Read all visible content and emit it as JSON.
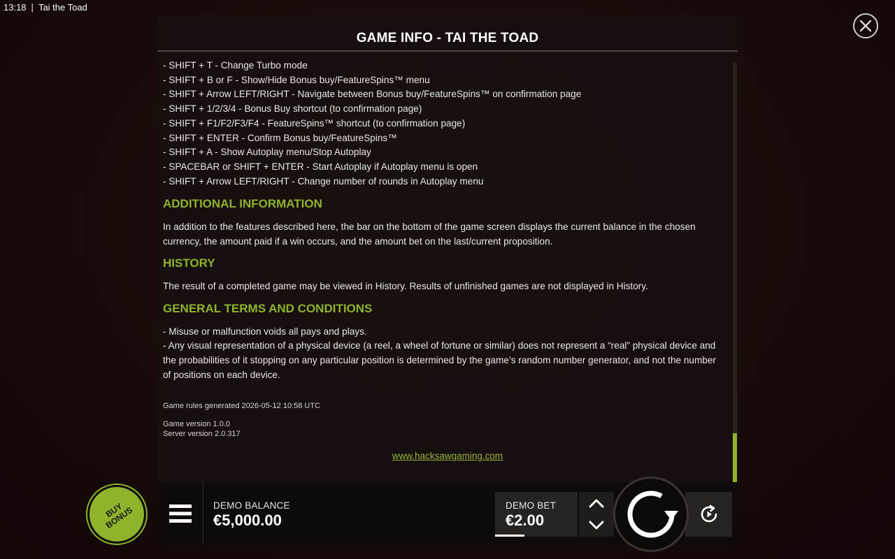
{
  "status_bar": {
    "time": "13:18",
    "app_title": "Tai the Toad"
  },
  "panel": {
    "title": "GAME INFO - TAI THE TOAD",
    "shortcuts": [
      "- SHIFT + T - Change Turbo mode",
      "- SHIFT + B or F - Show/Hide Bonus buy/FeatureSpins™ menu",
      "- SHIFT + Arrow LEFT/RIGHT - Navigate between Bonus buy/FeatureSpins™ on confirmation page",
      "- SHIFT + 1/2/3/4 - Bonus Buy shortcut (to confirmation page)",
      "- SHIFT + F1/F2/F3/F4 - FeatureSpins™ shortcut (to confirmation page)",
      "- SHIFT + ENTER - Confirm Bonus buy/FeatureSpins™",
      "- SHIFT + A - Show Autoplay menu/Stop Autoplay",
      "- SPACEBAR or SHIFT + ENTER - Start Autoplay if Autoplay menu is open",
      "- SHIFT + Arrow LEFT/RIGHT - Change number of rounds in Autoplay menu"
    ],
    "additional_heading": "ADDITIONAL INFORMATION",
    "additional_text": "In addition to the features described here, the bar on the bottom of the game screen displays the current balance in the chosen currency, the amount paid if a win occurs, and the amount bet on the last/current proposition.",
    "history_heading": "HISTORY",
    "history_text": "The result of a completed game may be viewed in History. Results of unfinished games are not displayed in History.",
    "terms_heading": "GENERAL TERMS AND CONDITIONS",
    "terms": [
      "- Misuse or malfunction voids all pays and plays.",
      "- Any visual representation of a physical device (a reel, a wheel of fortune or similar) does not represent a “real” physical device and the probabilities of it stopping on any particular position is determined by the game’s random number generator, and not the number of positions on each device."
    ],
    "rules_generated": "Game rules generated 2026-05-12 10:58 UTC",
    "game_version": "Game version 1.0.0",
    "server_version": "Server version 2.0.317",
    "link": "www.hacksawgaming.com"
  },
  "bottom_bar": {
    "balance_label": "DEMO BALANCE",
    "balance_value": "€5,000.00",
    "bet_label": "DEMO BET",
    "bet_value": "€2.00"
  },
  "buy_bonus": {
    "line1": "BUY",
    "line2": "BONUS"
  },
  "icons": {
    "close": "close-icon",
    "menu": "hamburger-menu-icon",
    "increase": "chevron-up-icon",
    "decrease": "chevron-down-icon",
    "spin": "spin-icon",
    "autoplay": "autoplay-icon"
  },
  "colors": {
    "accent": "#8fb32a",
    "panel_bg": "#16100e",
    "text": "#e8e8e8"
  }
}
